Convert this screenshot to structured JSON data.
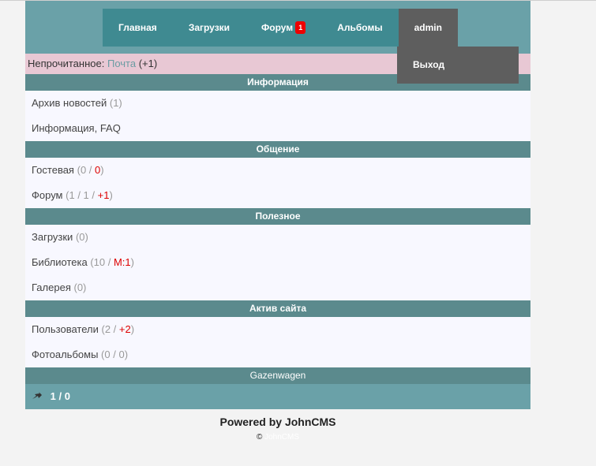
{
  "nav": {
    "items": [
      {
        "label": "Главная"
      },
      {
        "label": "Загрузки"
      },
      {
        "label": "Форум",
        "badge": "1"
      },
      {
        "label": "Альбомы"
      },
      {
        "label": "admin"
      }
    ],
    "dropdown_label": "Выход"
  },
  "unread": {
    "label": "Непрочитанное:",
    "mail_label": "Почта",
    "mail_count": "(+1)"
  },
  "sections": {
    "info": {
      "title": "Информация",
      "news_label": "Архив новостей",
      "news_count": "(1)",
      "faq_label": "Информация, FAQ"
    },
    "social": {
      "title": "Общение",
      "guest_label": "Гостевая",
      "guest_a": "0",
      "guest_b": "0",
      "forum_label": "Форум",
      "forum_a": "1",
      "forum_b": "1",
      "forum_c": "+1"
    },
    "useful": {
      "title": "Полезное",
      "downloads_label": "Загрузки",
      "downloads_count": "(0)",
      "library_label": "Библиотека",
      "library_a": "10",
      "library_b": "М:1",
      "gallery_label": "Галерея",
      "gallery_count": "(0)"
    },
    "active": {
      "title": "Актив сайта",
      "users_label": "Пользователи",
      "users_a": "2",
      "users_b": "+2",
      "photos_label": "Фотоальбомы",
      "photos_a": "0",
      "photos_b": "0"
    },
    "gazenwagen": {
      "title": "Gazenwagen",
      "value": "1 / 0"
    }
  },
  "footer": {
    "powered": "Powered by JohnCMS",
    "copyright_sign": "©",
    "copyright_name": "JohnCMS"
  },
  "colors": {
    "header_bg": "#6aa1a8",
    "nav_bg": "#3f8a91",
    "section_bg": "#5b8a8d",
    "unread_bg": "#e8c8d4",
    "badge": "#ee0000"
  }
}
